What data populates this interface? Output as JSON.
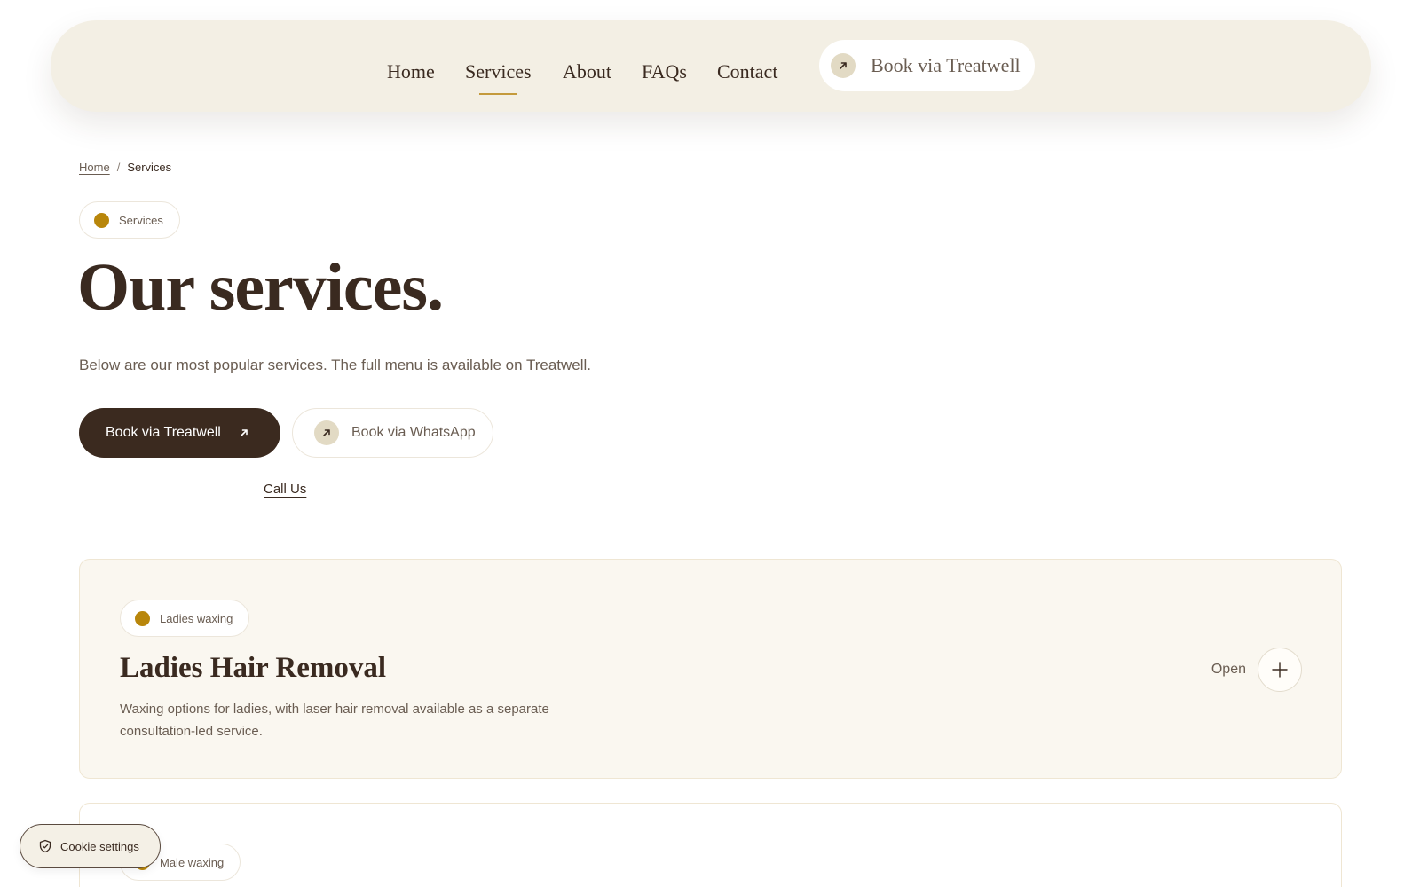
{
  "nav": {
    "items": [
      {
        "label": "Home",
        "active": false
      },
      {
        "label": "Services",
        "active": true
      },
      {
        "label": "About",
        "active": false
      },
      {
        "label": "FAQs",
        "active": false
      },
      {
        "label": "Contact",
        "active": false
      }
    ],
    "cta_label": "Book via Treatwell"
  },
  "breadcrumb": {
    "home": "Home",
    "separator": "/",
    "current": "Services"
  },
  "hero": {
    "pill_label": "Services",
    "title": "Our services.",
    "intro": "Below are our most popular services. The full menu is available on Treatwell.",
    "primary_button": "Book via Treatwell",
    "secondary_button": "Book via WhatsApp",
    "call_link": "Call Us"
  },
  "services": [
    {
      "pill_label": "Ladies waxing",
      "title": "Ladies Hair Removal",
      "description": "Waxing options for ladies, with laser hair removal available as a separate consultation-led service.",
      "toggle_label": "Open"
    },
    {
      "pill_label": "Male waxing"
    }
  ],
  "cookie": {
    "label": "Cookie settings"
  },
  "colors": {
    "header_bg": "#f3efe4",
    "primary_dark": "#3b2a1f",
    "accent_gold": "#b8860b",
    "card_bg": "#faf7f0"
  }
}
